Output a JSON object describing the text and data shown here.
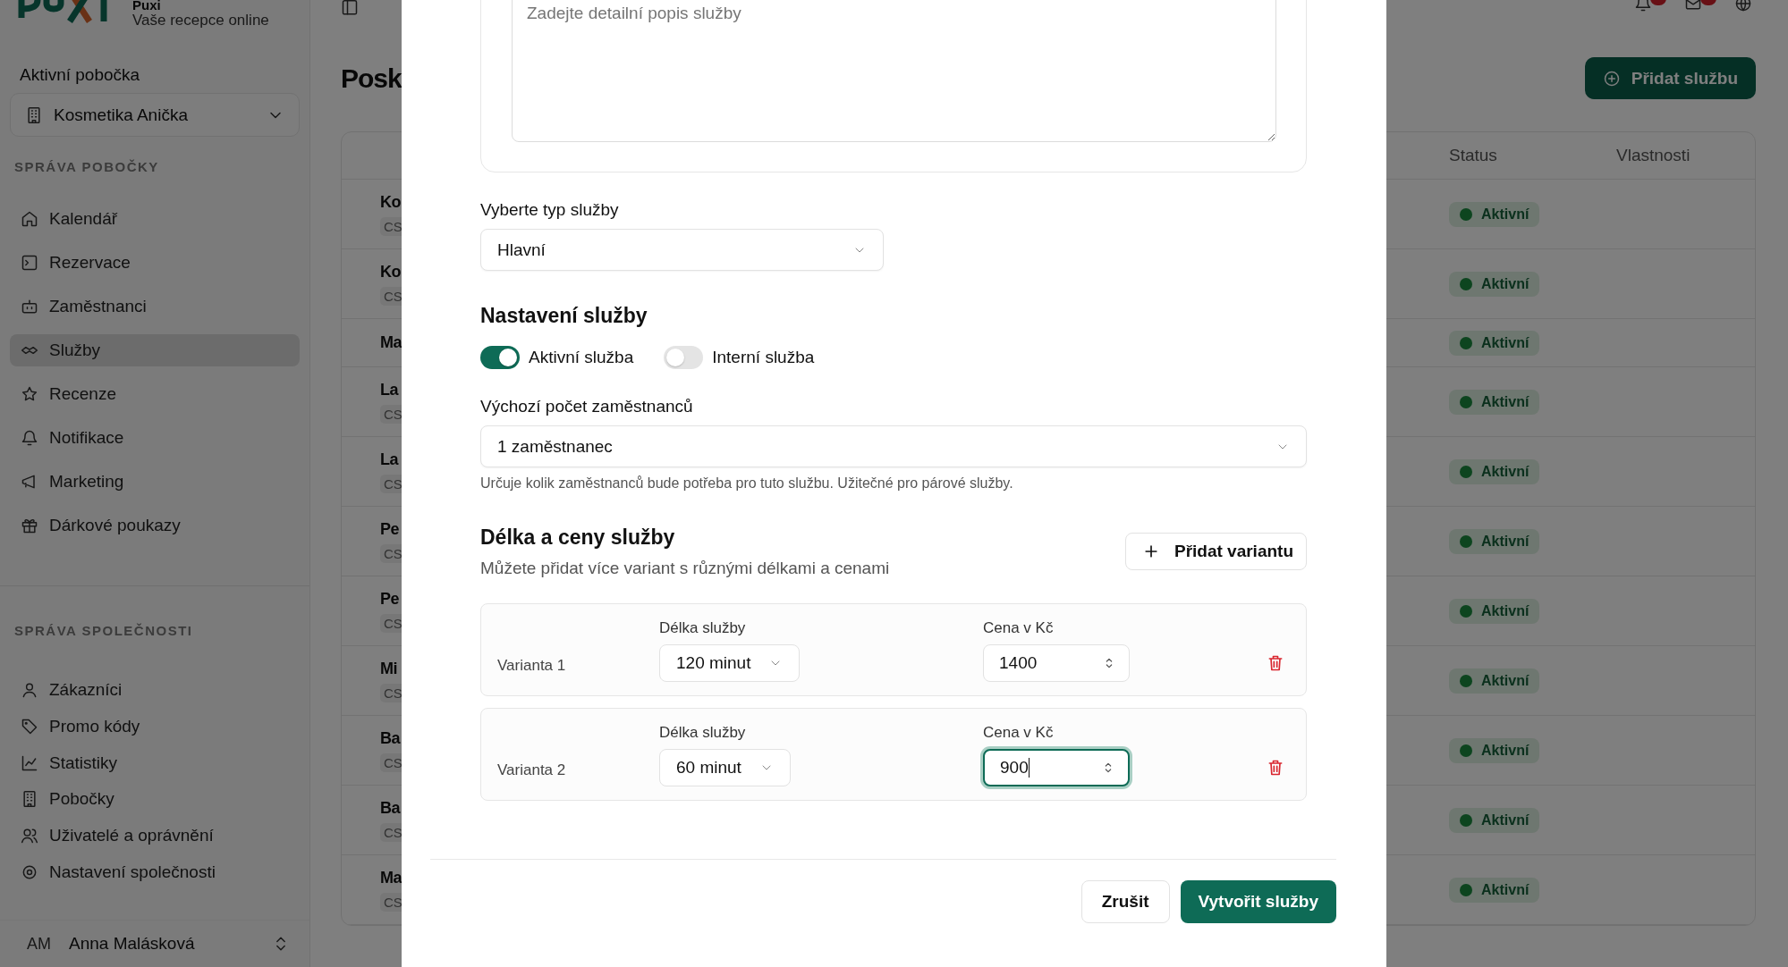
{
  "sidebar": {
    "brand": "Puxi",
    "tagline": "Vaše recepce online",
    "branch_label": "Aktivní pobočka",
    "branch": "Kosmetika Anička",
    "sections": [
      {
        "title": "SPRÁVA POBOČKY",
        "items": [
          {
            "label": "Kalendář",
            "selected": false
          },
          {
            "label": "Rezervace",
            "selected": false
          },
          {
            "label": "Zaměstnanci",
            "selected": false
          },
          {
            "label": "Služby",
            "selected": true
          },
          {
            "label": "Recenze",
            "selected": false
          },
          {
            "label": "Notifikace",
            "selected": false
          },
          {
            "label": "Marketing",
            "selected": false
          },
          {
            "label": "Dárkové poukazy",
            "selected": false
          }
        ]
      },
      {
        "title": "SPRÁVA SPOLEČNOSTI",
        "items": [
          {
            "label": "Zákazníci",
            "selected": false
          },
          {
            "label": "Promo kódy",
            "selected": false
          },
          {
            "label": "Statistiky",
            "selected": false
          },
          {
            "label": "Pobočky",
            "selected": false
          },
          {
            "label": "Uživatelé a oprávnění",
            "selected": false
          },
          {
            "label": "Nastavení společnosti",
            "selected": false
          }
        ]
      }
    ],
    "user": {
      "initials": "AM",
      "name": "Anna Malásková"
    }
  },
  "page": {
    "title": "Posk",
    "add_button": "Přidat službu",
    "table": {
      "columns": [
        "Status",
        "Vlastnosti"
      ],
      "rows": [
        {
          "name": "Ko",
          "code": "CS",
          "status": "Aktivní"
        },
        {
          "name": "Ko",
          "code": "CS",
          "status": "Aktivní"
        },
        {
          "name": "Ma",
          "status": "Aktivní"
        },
        {
          "name": "La",
          "code": "CS",
          "status": "Aktivní"
        },
        {
          "name": "La",
          "code": "CS",
          "status": "Aktivní"
        },
        {
          "name": "Pe",
          "code": "CS",
          "status": "Aktivní"
        },
        {
          "name": "Pe",
          "code": "CS",
          "status": "Aktivní"
        },
        {
          "name": "Mi",
          "code": "CS",
          "status": "Aktivní"
        },
        {
          "name": "Ba",
          "code": "CS",
          "status": "Aktivní"
        },
        {
          "name": "Ba",
          "code": "CS",
          "status": "Aktivní"
        },
        {
          "name": "Ma",
          "code": "CS",
          "status": "Aktivní"
        }
      ]
    }
  },
  "modal": {
    "description": {
      "placeholder": "Zadejte detailní popis služby"
    },
    "type": {
      "label": "Vyberte typ služby",
      "value": "Hlavní"
    },
    "settings": {
      "title": "Nastavení služby",
      "toggles": [
        {
          "label": "Aktivní služba",
          "on": true
        },
        {
          "label": "Interní služba",
          "on": false
        }
      ]
    },
    "staff": {
      "label": "Výchozí počet zaměstnanců",
      "value": "1 zaměstnanec",
      "hint": "Určuje kolik zaměstnanců bude potřeba pro tuto službu. Užitečné pro párové služby."
    },
    "variants_section": {
      "title": "Délka a ceny služby",
      "subtitle": "Můžete přidat více variant s různými délkami a cenami",
      "add_button": "Přidat variantu"
    },
    "variants": [
      {
        "label": "Varianta 1",
        "duration_label": "Délka služby",
        "duration": "120 minut",
        "price_label": "Cena v Kč",
        "price": "1400",
        "focused": false
      },
      {
        "label": "Varianta 2",
        "duration_label": "Délka služby",
        "duration": "60 minut",
        "price_label": "Cena v Kč",
        "price": "900",
        "focused": true
      }
    ],
    "buttons": {
      "cancel": "Zrušit",
      "submit": "Vytvořit služby"
    }
  }
}
